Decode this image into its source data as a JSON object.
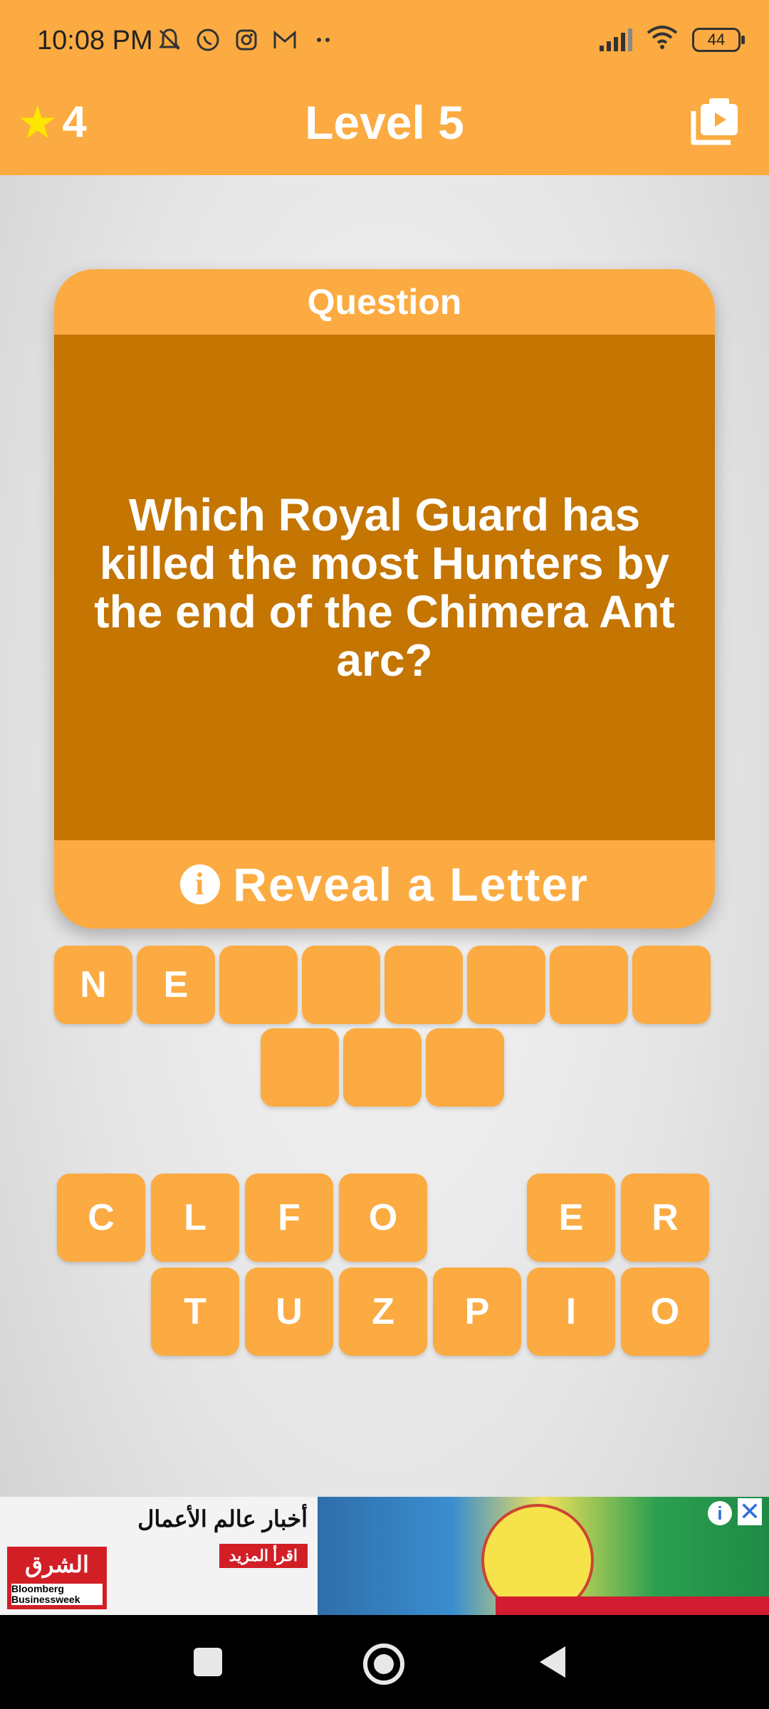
{
  "status_bar": {
    "time": "10:08 PM",
    "battery": "44",
    "icons": [
      "mute-icon",
      "whatsapp-icon",
      "instagram-icon",
      "gmail-icon",
      "more-dots-icon",
      "signal-icon",
      "wifi-icon",
      "battery-icon"
    ]
  },
  "header": {
    "stars": "4",
    "level_title": "Level 5"
  },
  "card": {
    "header_label": "Question",
    "question": "Which Royal Guard has killed the most Hunters by the end of the Chimera Ant arc?",
    "reveal_label": "Reveal a Letter"
  },
  "answer_slots": {
    "row1": [
      "N",
      "E",
      "",
      "",
      "",
      "",
      "",
      ""
    ],
    "row2": [
      "",
      "",
      ""
    ]
  },
  "keyboard": {
    "row1": [
      "C",
      "L",
      "F",
      "O",
      "",
      "E",
      "R"
    ],
    "row2": [
      "T",
      "U",
      "Z",
      "P",
      "I",
      "O"
    ]
  },
  "ad": {
    "headline": "أخبار عالم الأعمال",
    "cta": "اقرأ المزيد",
    "logo_text": "الشرق",
    "logo_sub": "Bloomberg Businessweek"
  },
  "colors": {
    "accent": "#fbab41",
    "card_body": "#c47502",
    "star": "#ffe600"
  }
}
